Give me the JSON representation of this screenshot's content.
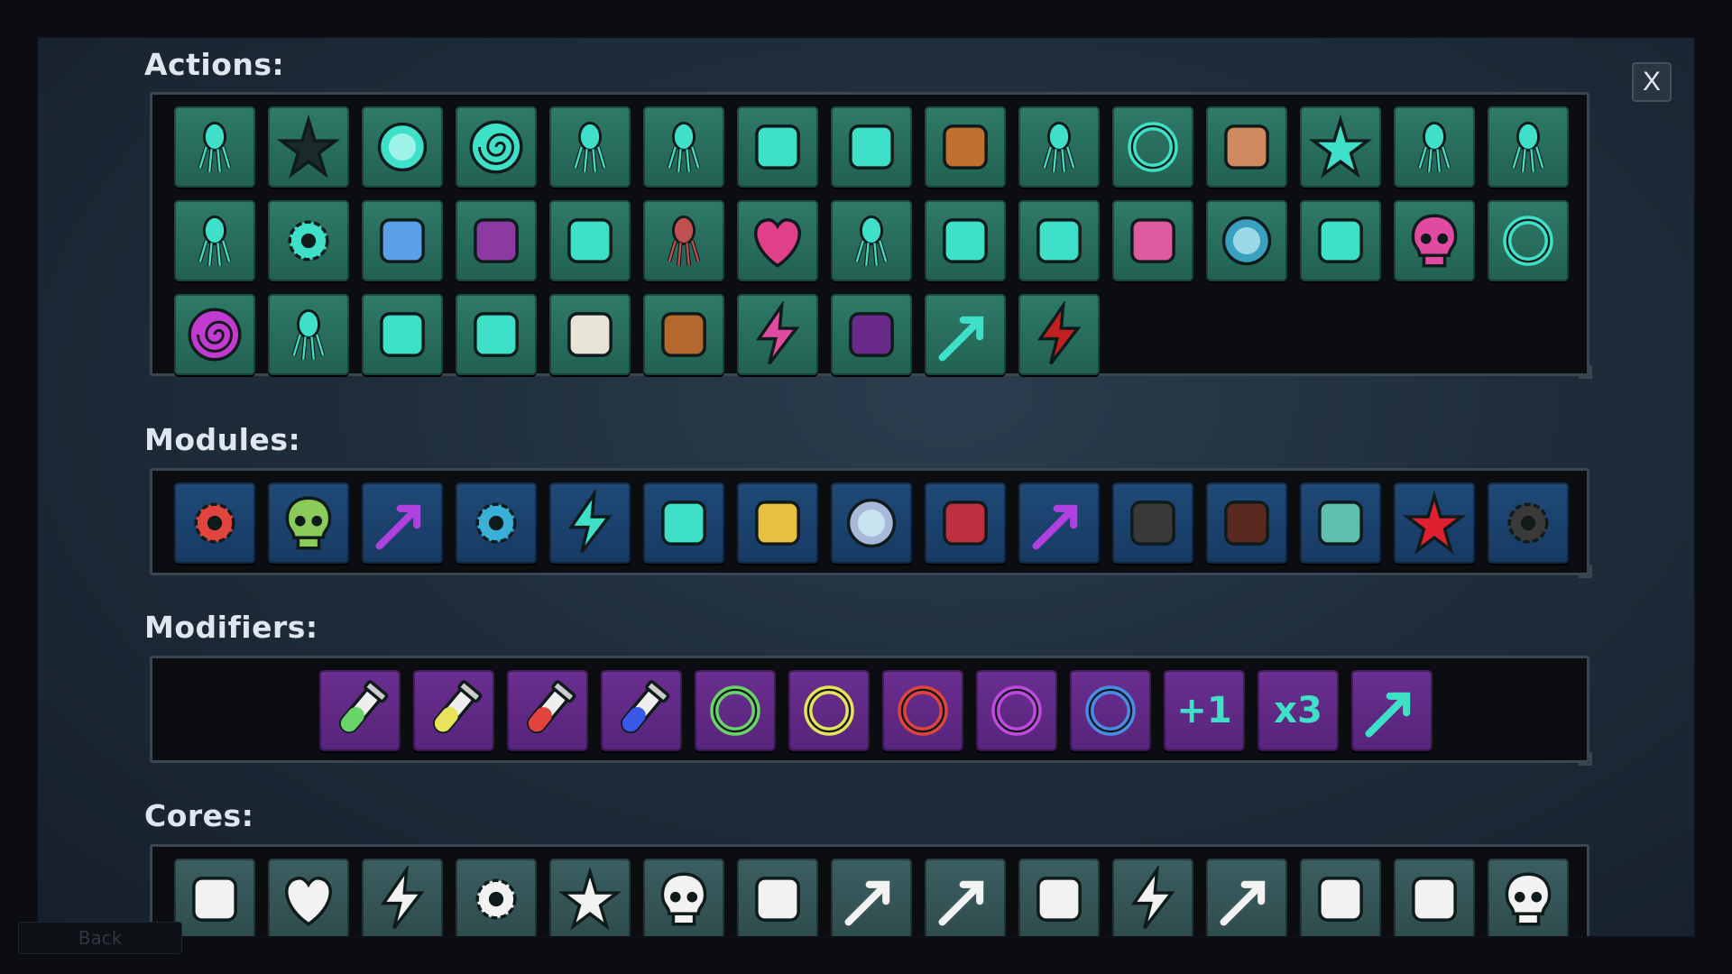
{
  "close_label": "X",
  "back_label": "Back",
  "sections": {
    "actions": {
      "title": "Actions:"
    },
    "modules": {
      "title": "Modules:"
    },
    "modifiers": {
      "title": "Modifiers:"
    },
    "cores": {
      "title": "Cores:"
    }
  },
  "actions": [
    "squid-dash-icon",
    "urchin-spikes-icon",
    "bubble-orb-icon",
    "whirlpool-icon",
    "squid-icon",
    "ghost-squid-icon",
    "tentacle-icon",
    "spore-cluster-icon",
    "boomerang-icon",
    "ink-squid-icon",
    "coral-ring-icon",
    "hammer-icon",
    "starfish-trio-icon",
    "squid-skull-icon",
    "squid-charge-icon",
    "squid-pair-icon",
    "gear-eye-icon",
    "water-drop-icon",
    "brain-coral-icon",
    "tube-coral-icon",
    "red-squid-icon",
    "hearts-icon",
    "sparkle-squid-icon",
    "sea-creature-icon",
    "dolphin-icon",
    "music-notes-icon",
    "egg-icon",
    "trident-icon",
    "pink-ghost-icon",
    "net-icon",
    "purple-spiral-icon",
    "squid-swarm-icon",
    "sonar-wave-icon",
    "pufferfish-icon",
    "whale-icon",
    "barrel-icon",
    "pink-lightning-icon",
    "pentagram-icon",
    "missile-icon",
    "blood-lightning-icon"
  ],
  "modules": [
    "crosshair-icon",
    "skull-icon",
    "bounce-arrow-icon",
    "stopwatch-icon",
    "lightning-icon",
    "fist-down-icon",
    "party-popper-icon",
    "moon-orb-icon",
    "flesh-tentacle-icon",
    "split-arrow-icon",
    "crossed-hammers-icon",
    "bow-icon",
    "dna-icon",
    "red-spark-icon",
    "beacon-icon"
  ],
  "modifiers": [
    {
      "icon": "green-vial-icon",
      "color": "#6ad36a"
    },
    {
      "icon": "yellow-vial-icon",
      "color": "#e8e35a"
    },
    {
      "icon": "red-vial-icon",
      "color": "#e0443c"
    },
    {
      "icon": "blue-vial-icon",
      "color": "#3a58e8"
    },
    {
      "icon": "green-syringe-icon",
      "color": "#6ad36a"
    },
    {
      "icon": "yellow-syringe-icon",
      "color": "#e8e35a"
    },
    {
      "icon": "red-syringe-icon",
      "color": "#e0443c"
    },
    {
      "icon": "purple-syringe-icon",
      "color": "#c04ae0"
    },
    {
      "icon": "blue-syringe-icon",
      "color": "#4a8be8"
    },
    {
      "icon": "plus-one-text",
      "text": "+1"
    },
    {
      "icon": "times-three-text",
      "text": "x3"
    },
    {
      "icon": "zigzag-arrow-icon"
    }
  ],
  "cores": [
    "dumbbell-icon",
    "heart-icon",
    "lightning-pair-icon",
    "gears-icon",
    "shuriken-icon",
    "ram-skull-icon",
    "cowboy-hat-icon",
    "dots-arrow-icon",
    "sword-icon",
    "carrot-icon",
    "flash-icon",
    "fast-forward-icon",
    "battle-axe-icon",
    "hourglass-icon",
    "skull-crossbones-icon"
  ],
  "colors": {
    "action_tile": "#2a6f5e",
    "module_tile": "#1f4a78",
    "modifier_tile": "#612a85",
    "core_tile": "#355658",
    "accent_teal": "#3fe0c8",
    "panel_bg": "#0b0d10"
  }
}
